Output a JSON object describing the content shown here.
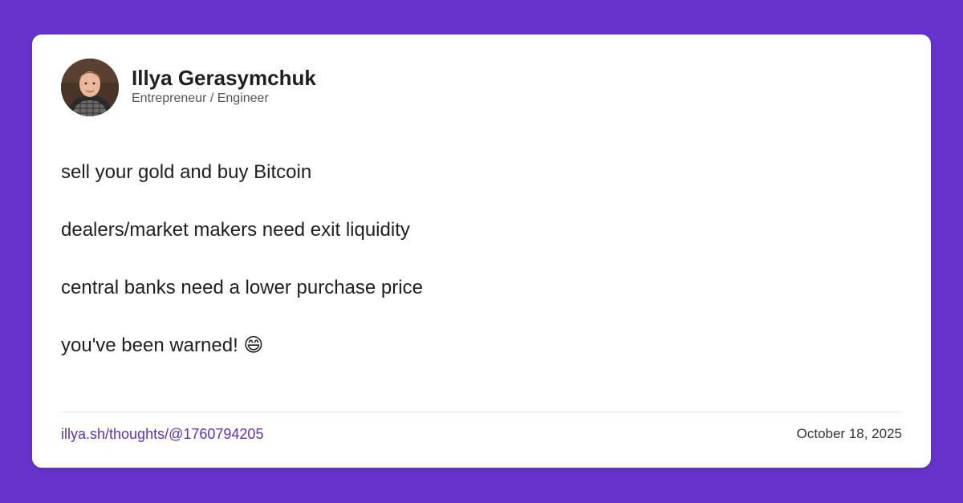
{
  "author": {
    "name": "Illya Gerasymchuk",
    "title": "Entrepreneur / Engineer"
  },
  "post": {
    "lines": [
      "sell your gold and buy Bitcoin",
      "dealers/market makers need exit liquidity",
      "central banks need a lower purchase price",
      "you've been warned! 😄"
    ]
  },
  "footer": {
    "link": "illya.sh/thoughts/@1760794205",
    "date": "October 18, 2025"
  },
  "colors": {
    "background": "#6633cc",
    "card": "#ffffff",
    "link": "#5b2fc4"
  }
}
